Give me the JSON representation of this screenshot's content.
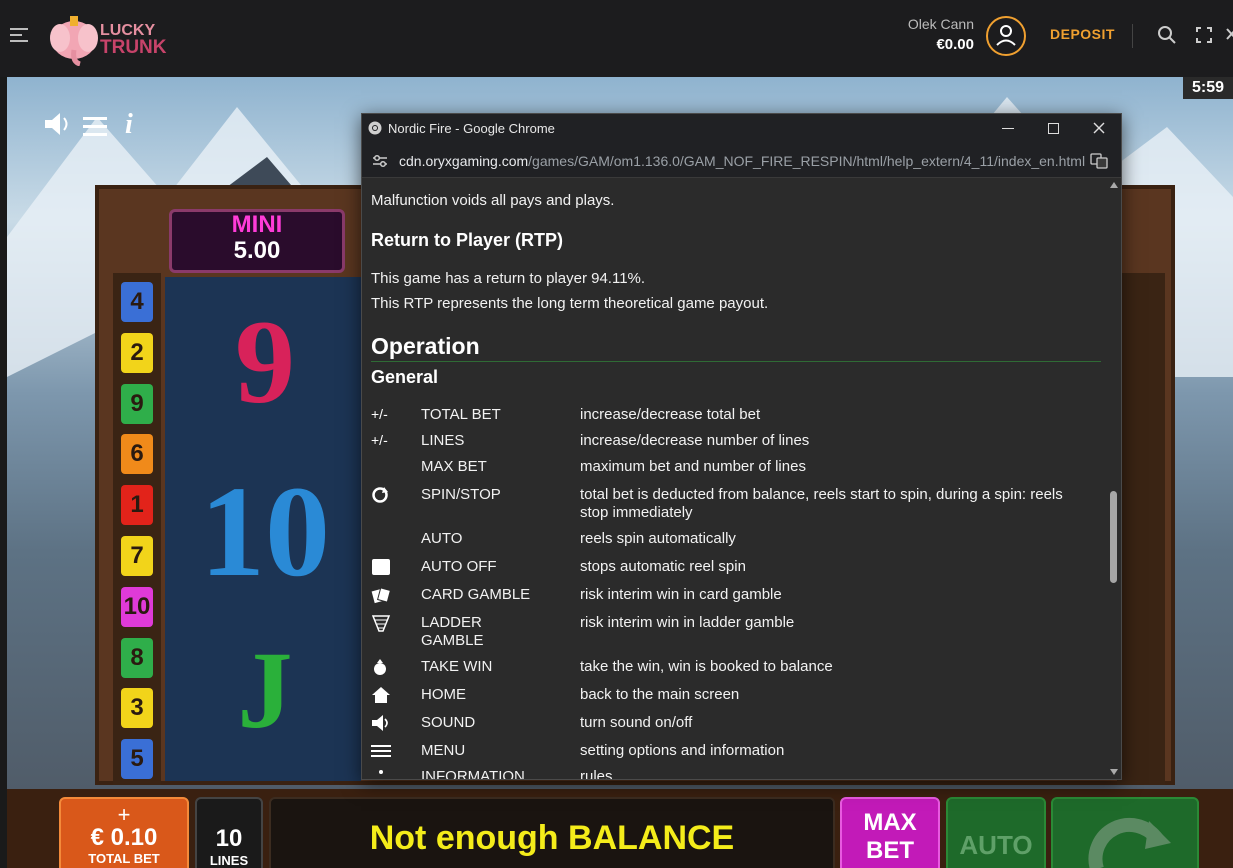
{
  "site": {
    "logo_line1": "LUCKY",
    "logo_line2": "TRUNK",
    "user_name": "Olek Cann",
    "balance": "€0.00",
    "deposit_label": "DEPOSIT"
  },
  "game": {
    "clock": "5:59",
    "jackpot_title": "MINI",
    "jackpot_value": "5.00",
    "line_numbers_left": [
      "4",
      "2",
      "9",
      "6",
      "1",
      "7",
      "10",
      "8",
      "3",
      "5"
    ],
    "reel_symbols": [
      "9",
      "10",
      "J"
    ],
    "total_bet_plus": "+",
    "total_bet_value": "€ 0.10",
    "total_bet_label": "TOTAL BET",
    "lines_value": "10",
    "lines_label": "LINES",
    "message": "Not enough BALANCE",
    "maxbet_label": "MAX BET",
    "auto_label": "AUTO",
    "colors": {
      "badge_blue": "#3a6fd6",
      "badge_yellow": "#f2d41a",
      "badge_green": "#2fae4a",
      "badge_orange": "#f08a1a",
      "badge_red": "#e2231a",
      "badge_magenta": "#e03ad8"
    }
  },
  "popup": {
    "window_title": "Nordic Fire - Google Chrome",
    "url_host": "cdn.oryxgaming.com",
    "url_path": "/games/GAM/om1.136.0/GAM_NOF_FIRE_RESPIN/html/help_extern/4_11/index_en.html",
    "malfunction": "Malfunction voids all pays and plays.",
    "rtp_heading": "Return to Player (RTP)",
    "rtp_line1": "This game has a return to player 94.11%.",
    "rtp_line2": "This RTP represents the long term theoretical game payout.",
    "operation_heading": "Operation",
    "general_heading": "General",
    "rows": [
      {
        "icon": "+/-",
        "name": "TOTAL BET",
        "desc": "increase/decrease total bet"
      },
      {
        "icon": "+/-",
        "name": "LINES",
        "desc": "increase/decrease number of lines"
      },
      {
        "icon": "",
        "name": "MAX BET",
        "desc": "maximum bet and number of lines"
      },
      {
        "icon": "",
        "name": "SPIN/STOP",
        "desc": "total bet is deducted from balance, reels start to spin, during a spin: reels stop immediately"
      },
      {
        "icon": "",
        "name": "AUTO",
        "desc": "reels spin automatically"
      },
      {
        "icon": "",
        "name": "AUTO OFF",
        "desc": "stops automatic reel spin"
      },
      {
        "icon": "",
        "name": "CARD GAMBLE",
        "desc": "risk interim win in card gamble"
      },
      {
        "icon": "",
        "name": "LADDER GAMBLE",
        "desc": "risk interim win in ladder gamble"
      },
      {
        "icon": "",
        "name": "TAKE WIN",
        "desc": "take the win, win is booked to balance"
      },
      {
        "icon": "",
        "name": "HOME",
        "desc": "back to the main screen"
      },
      {
        "icon": "",
        "name": "SOUND",
        "desc": "turn sound on/off"
      },
      {
        "icon": "",
        "name": "MENU",
        "desc": "setting options and information"
      },
      {
        "icon": "",
        "name": "INFORMATION",
        "desc": "rules"
      }
    ],
    "scroll_position": 0.62
  }
}
